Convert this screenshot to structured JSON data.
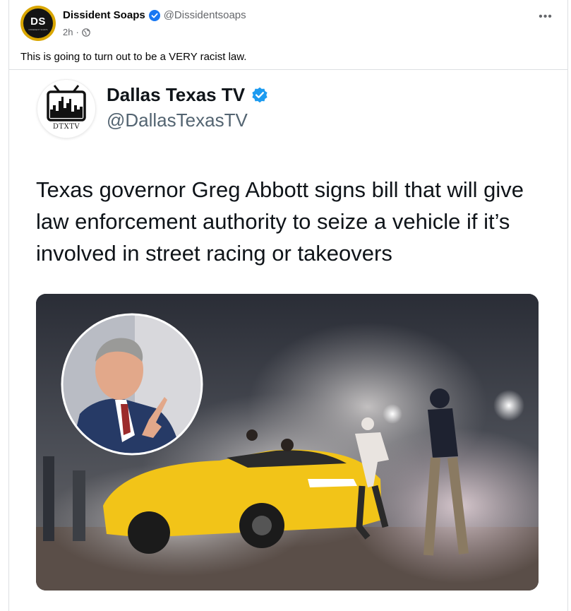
{
  "post": {
    "author": {
      "name": "Dissident Soaps",
      "handle": "@Dissidentsoaps",
      "avatar_initials": "DS",
      "avatar_subtext": "DISSIDENT SOAPS",
      "verified_icon": "verified-badge-icon"
    },
    "time": "2h",
    "separator": "·",
    "audience_icon": "globe-icon",
    "more_label": "•••",
    "text": "This is going to turn out to be a VERY racist law."
  },
  "shared_tweet": {
    "author": {
      "name": "Dallas Texas TV",
      "handle": "@DallasTexasTV",
      "avatar_label": "DTXTV"
    },
    "body": "Texas governor Greg Abbott signs bill that will give law enforcement authority to seize a vehicle if it’s involved in street racing or takeovers",
    "image_icon": "street-takeover-photo"
  },
  "colors": {
    "verified": "#1877f2",
    "twitter_verified": "#1d9bf0",
    "avatar_ring": "#d9a600",
    "car_yellow": "#f2c418"
  }
}
